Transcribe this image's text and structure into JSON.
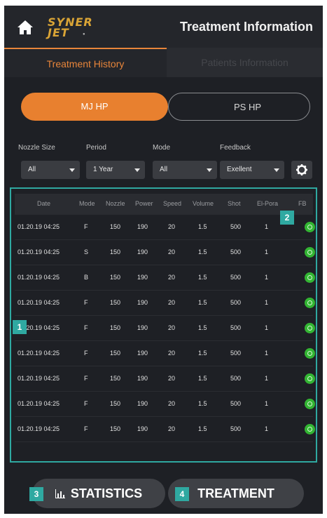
{
  "header": {
    "logo_line1": "SYNER",
    "logo_line2": "JET",
    "title": "Treatment Information"
  },
  "tabs": [
    {
      "label": "Treatment History",
      "active": true
    },
    {
      "label": "Patients Information",
      "active": false
    }
  ],
  "handpiece_toggle": [
    {
      "label": "MJ HP",
      "selected": true
    },
    {
      "label": "PS HP",
      "selected": false
    }
  ],
  "filters": {
    "nozzle_size": {
      "label": "Nozzle Size",
      "value": "All"
    },
    "period": {
      "label": "Period",
      "value": "1 Year"
    },
    "mode": {
      "label": "Mode",
      "value": "All"
    },
    "feedback": {
      "label": "Feedback",
      "value": "Exellent"
    }
  },
  "table": {
    "columns": [
      "Date",
      "Mode",
      "Nozzle",
      "Power",
      "Speed",
      "Volume",
      "Shot",
      "El-Pora",
      "FB"
    ],
    "rows": [
      [
        "01.20.19 04:25",
        "F",
        "150",
        "190",
        "20",
        "1.5",
        "500",
        "1"
      ],
      [
        "01.20.19 04:25",
        "S",
        "150",
        "190",
        "20",
        "1.5",
        "500",
        "1"
      ],
      [
        "01.20.19 04:25",
        "B",
        "150",
        "190",
        "20",
        "1.5",
        "500",
        "1"
      ],
      [
        "01.20.19 04:25",
        "F",
        "150",
        "190",
        "20",
        "1.5",
        "500",
        "1"
      ],
      [
        "01.20.19 04:25",
        "F",
        "150",
        "190",
        "20",
        "1.5",
        "500",
        "1"
      ],
      [
        "01.20.19 04:25",
        "F",
        "150",
        "190",
        "20",
        "1.5",
        "500",
        "1"
      ],
      [
        "01.20.19 04:25",
        "F",
        "150",
        "190",
        "20",
        "1.5",
        "500",
        "1"
      ],
      [
        "01.20.19 04:25",
        "F",
        "150",
        "190",
        "20",
        "1.5",
        "500",
        "1"
      ],
      [
        "01.20.19 04:25",
        "F",
        "150",
        "190",
        "20",
        "1.5",
        "500",
        "1"
      ]
    ],
    "feedback_icon": "green-smile-icon"
  },
  "callouts": [
    "1",
    "2",
    "3",
    "4"
  ],
  "buttons": {
    "statistics": "STATISTICS",
    "treatment": "TREATMENT"
  },
  "colors": {
    "accent": "#e8802f",
    "callout": "#2fa9a1",
    "background": "#1e2025",
    "feedback_good": "#33b533"
  }
}
